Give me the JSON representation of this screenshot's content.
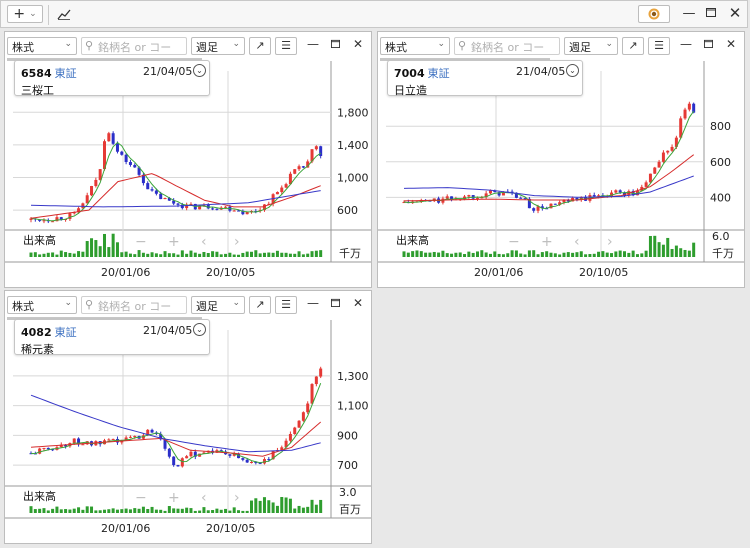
{
  "toolbar": {
    "add_label": "+",
    "add_caret": "⌄",
    "chart_btn": "↗"
  },
  "colors": {
    "up": "#e53935",
    "down": "#2b2fc9",
    "ma_short": "#3aa53a",
    "ma_mid": "#d62c2c",
    "ma_long": "#3838c8",
    "volume": "#2e9d2e",
    "grid": "#d8d8d8"
  },
  "panels": [
    {
      "market_select": "株式",
      "search_placeholder": "銘柄名 or コード",
      "period_select": "週足",
      "code": "6584",
      "exchange": "東証",
      "date": "21/04/05",
      "name": "三桜工",
      "volume_label": "出来高",
      "volume_unit": "千万",
      "nav": {
        "minus": "−",
        "plus": "+",
        "prev": "‹",
        "next": "›"
      },
      "chart_data": {
        "type": "candlestick",
        "x_ticks": [
          "20/01/06",
          "20/10/05"
        ],
        "y_ticks": [
          "1,800",
          "1,400",
          "1,000",
          "600"
        ],
        "volume_ticks": [],
        "y_range": [
          430,
          2000
        ],
        "volume_max": 100,
        "price_waypoints": [
          [
            0,
            480
          ],
          [
            0.08,
            500
          ],
          [
            0.15,
            540
          ],
          [
            0.2,
            800
          ],
          [
            0.24,
            1100
          ],
          [
            0.26,
            1650
          ],
          [
            0.3,
            1300
          ],
          [
            0.36,
            1100
          ],
          [
            0.42,
            800
          ],
          [
            0.48,
            700
          ],
          [
            0.55,
            640
          ],
          [
            0.62,
            650
          ],
          [
            0.7,
            620
          ],
          [
            0.75,
            560
          ],
          [
            0.8,
            640
          ],
          [
            0.86,
            850
          ],
          [
            0.9,
            1050
          ],
          [
            0.95,
            1150
          ],
          [
            0.98,
            1400
          ],
          [
            1.0,
            1250
          ]
        ],
        "ma": {
          "short": true,
          "mid": [
            [
              0,
              500
            ],
            [
              0.2,
              600
            ],
            [
              0.3,
              950
            ],
            [
              0.42,
              1050
            ],
            [
              0.5,
              900
            ],
            [
              0.6,
              720
            ],
            [
              0.7,
              640
            ],
            [
              0.8,
              640
            ],
            [
              0.9,
              760
            ],
            [
              1.0,
              900
            ]
          ],
          "long": [
            [
              0,
              660
            ],
            [
              0.25,
              640
            ],
            [
              0.5,
              650
            ],
            [
              0.75,
              690
            ],
            [
              1.0,
              840
            ]
          ]
        }
      }
    },
    {
      "market_select": "株式",
      "search_placeholder": "銘柄名 or コード",
      "period_select": "週足",
      "code": "7004",
      "exchange": "東証",
      "date": "21/04/05",
      "name": "日立造",
      "volume_label": "出来高",
      "volume_unit": "千万",
      "nav": {
        "minus": "−",
        "plus": "+",
        "prev": "‹",
        "next": "›"
      },
      "chart_data": {
        "type": "candlestick",
        "x_ticks": [
          "20/01/06",
          "20/10/05"
        ],
        "y_ticks": [
          "800",
          "600",
          "400"
        ],
        "volume_ticks": [
          "6.0"
        ],
        "y_range": [
          250,
          970
        ],
        "volume_max": 6.0,
        "price_waypoints": [
          [
            0,
            370
          ],
          [
            0.1,
            380
          ],
          [
            0.2,
            400
          ],
          [
            0.28,
            420
          ],
          [
            0.35,
            430
          ],
          [
            0.4,
            400
          ],
          [
            0.45,
            330
          ],
          [
            0.5,
            350
          ],
          [
            0.58,
            380
          ],
          [
            0.65,
            400
          ],
          [
            0.72,
            430
          ],
          [
            0.8,
            420
          ],
          [
            0.83,
            470
          ],
          [
            0.86,
            560
          ],
          [
            0.9,
            650
          ],
          [
            0.94,
            720
          ],
          [
            0.96,
            870
          ],
          [
            0.98,
            930
          ],
          [
            1.0,
            860
          ]
        ],
        "ma": {
          "short": true,
          "mid": [
            [
              0,
              380
            ],
            [
              0.3,
              390
            ],
            [
              0.45,
              385
            ],
            [
              0.6,
              385
            ],
            [
              0.75,
              410
            ],
            [
              0.85,
              460
            ],
            [
              0.92,
              540
            ],
            [
              1.0,
              640
            ]
          ],
          "long": [
            [
              0,
              450
            ],
            [
              0.15,
              455
            ],
            [
              0.3,
              440
            ],
            [
              0.45,
              410
            ],
            [
              0.6,
              400
            ],
            [
              0.75,
              405
            ],
            [
              0.85,
              430
            ],
            [
              1.0,
              520
            ]
          ]
        }
      }
    },
    {
      "market_select": "株式",
      "search_placeholder": "銘柄名 or コード",
      "period_select": "週足",
      "code": "4082",
      "exchange": "東証",
      "date": "21/04/05",
      "name": "稀元素",
      "volume_label": "出来高",
      "volume_unit": "百万",
      "nav": {
        "minus": "−",
        "plus": "+",
        "prev": "‹",
        "next": "›"
      },
      "chart_data": {
        "type": "candlestick",
        "x_ticks": [
          "20/01/06",
          "20/10/05"
        ],
        "y_ticks": [
          "1,300",
          "1,100",
          "900",
          "700"
        ],
        "volume_ticks": [
          "3.0"
        ],
        "y_range": [
          600,
          1440
        ],
        "volume_max": 3.0,
        "price_waypoints": [
          [
            0,
            780
          ],
          [
            0.08,
            820
          ],
          [
            0.15,
            860
          ],
          [
            0.22,
            840
          ],
          [
            0.3,
            860
          ],
          [
            0.38,
            900
          ],
          [
            0.42,
            940
          ],
          [
            0.45,
            880
          ],
          [
            0.48,
            760
          ],
          [
            0.5,
            690
          ],
          [
            0.55,
            770
          ],
          [
            0.62,
            800
          ],
          [
            0.7,
            760
          ],
          [
            0.75,
            720
          ],
          [
            0.8,
            720
          ],
          [
            0.85,
            800
          ],
          [
            0.9,
            900
          ],
          [
            0.95,
            1100
          ],
          [
            0.98,
            1300
          ],
          [
            1.0,
            1360
          ]
        ],
        "ma": {
          "short": true,
          "mid": [
            [
              0,
              820
            ],
            [
              0.3,
              860
            ],
            [
              0.45,
              880
            ],
            [
              0.55,
              800
            ],
            [
              0.7,
              780
            ],
            [
              0.8,
              760
            ],
            [
              0.9,
              820
            ],
            [
              1.0,
              990
            ]
          ],
          "long": [
            [
              0,
              1170
            ],
            [
              0.15,
              1060
            ],
            [
              0.3,
              960
            ],
            [
              0.45,
              880
            ],
            [
              0.6,
              830
            ],
            [
              0.75,
              790
            ],
            [
              0.9,
              800
            ],
            [
              1.0,
              850
            ]
          ]
        }
      }
    }
  ]
}
